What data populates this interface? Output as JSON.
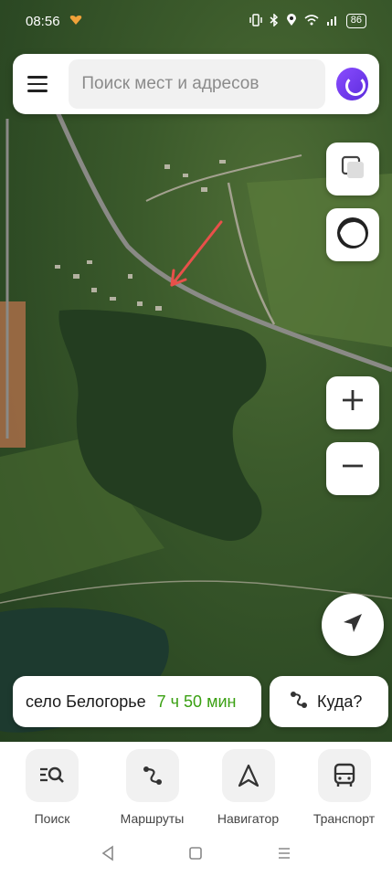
{
  "status": {
    "time": "08:56",
    "battery": "86",
    "icons": [
      "vibrate-icon",
      "bluetooth-icon",
      "location-icon",
      "wifi-icon",
      "signal-icon"
    ]
  },
  "search": {
    "placeholder": "Поиск мест и адресов"
  },
  "route": {
    "destination": "село Белогорье",
    "eta": "7 ч 50 мин",
    "eta_color": "#3aa012"
  },
  "where": {
    "label": "Куда?"
  },
  "tabs": [
    {
      "label": "Поиск",
      "icon": "search-list-icon"
    },
    {
      "label": "Маршруты",
      "icon": "routes-icon"
    },
    {
      "label": "Навигатор",
      "icon": "navigator-icon"
    },
    {
      "label": "Транспорт",
      "icon": "bus-icon"
    }
  ],
  "colors": {
    "accent_alice": "#6a3cf0",
    "arrow_annotation": "#e8504a"
  }
}
